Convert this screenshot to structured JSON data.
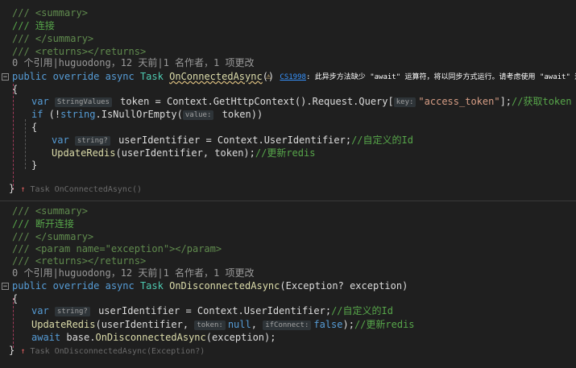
{
  "block1": {
    "doc": [
      "/// <summary>",
      "/// 连接",
      "/// </summary>",
      "/// <returns></returns>"
    ],
    "codelens": "0 个引用|huguodong，12 天前|1 名作者，1 项更改",
    "signature": {
      "mods": "public override async",
      "ret": "Task",
      "name": "OnConnectedAsync",
      "parens": "()"
    },
    "warning": {
      "code": "CS1998",
      "text": ": 此异步方法缺少 \"await\" 运算符，将以同步方式运行。请考虑使用 \"await\" 运"
    },
    "line_open": "{",
    "l1": {
      "kw": "var",
      "hint": "StringValues",
      "rest": " token = Context.GetHttpContext().Request.Query[",
      "hint2": "key:",
      "str": "\"access_token\"",
      "tail": "];",
      "cmt": "//获取token"
    },
    "l2": {
      "kw": "if",
      "rest": " (!",
      "kw2": "string",
      "mid": ".IsNullOrEmpty(",
      "hint": "value:",
      "tail": " token))"
    },
    "l3": "{",
    "l4": {
      "kw": "var",
      "hint": "string?",
      "rest": " userIdentifier = Context.UserIdentifier;",
      "cmt": "//自定义的Id"
    },
    "l5": {
      "meth": "UpdateRedis",
      "rest": "(userIdentifier, token);",
      "cmt": "//更新redis"
    },
    "l6": "}",
    "line_close": "}",
    "end_hint": "Task OnConnectedAsync()"
  },
  "block2": {
    "doc": [
      "/// <summary>",
      "/// 断开连接",
      "/// </summary>",
      "/// <param name=\"exception\"></param>",
      "/// <returns></returns>"
    ],
    "codelens": "0 个引用|huguodong，12 天前|1 名作者，1 项更改",
    "signature": {
      "mods": "public override async",
      "ret": "Task",
      "name": "OnDisconnectedAsync",
      "params": "(Exception? exception)"
    },
    "line_open": "{",
    "l1": {
      "kw": "var",
      "hint": "string?",
      "rest": " userIdentifier = Context.UserIdentifier;",
      "cmt": "//自定义的Id"
    },
    "l2": {
      "meth": "UpdateRedis",
      "rest": "(userIdentifier, ",
      "hint": "token:",
      "kwv": "null",
      "sep": ", ",
      "hint2": "ifConnect:",
      "kwv2": "false",
      "tail": ");",
      "cmt": "//更新redis"
    },
    "l3": {
      "kw": "await",
      "rest": " base.",
      "meth": "OnDisconnectedAsync",
      "tail": "(exception);"
    },
    "line_close": "}",
    "end_hint": "Task OnDisconnectedAsync(Exception?)"
  }
}
